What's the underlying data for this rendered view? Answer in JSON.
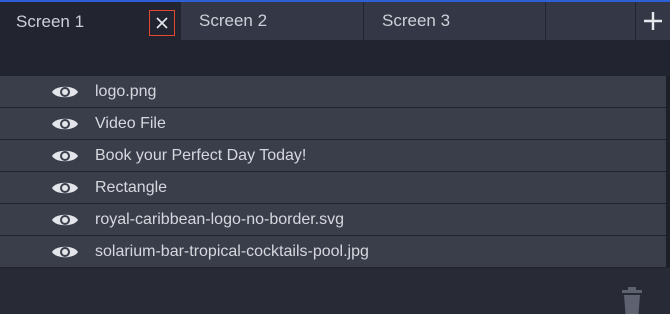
{
  "tabs": [
    {
      "label": "Screen 1",
      "active": true
    },
    {
      "label": "Screen 2",
      "active": false
    },
    {
      "label": "Screen 3",
      "active": false
    }
  ],
  "tab_close_icon": "close-icon",
  "add_tab_icon": "plus-icon",
  "layers": [
    {
      "label": "logo.png",
      "icon": "eye-icon"
    },
    {
      "label": "Video File",
      "icon": "eye-icon"
    },
    {
      "label": "Book your Perfect Day Today!",
      "icon": "eye-icon"
    },
    {
      "label": "Rectangle",
      "icon": "eye-icon"
    },
    {
      "label": "royal-caribbean-logo-no-border.svg",
      "icon": "eye-icon"
    },
    {
      "label": "solarium-bar-tropical-cocktails-pool.jpg",
      "icon": "eye-icon"
    }
  ],
  "footer": {
    "delete_icon": "trash-icon"
  },
  "colors": {
    "accent": "#2d5fd6",
    "close_highlight": "#e0482f",
    "row_bg": "#3a3e4b",
    "panel_bg": "#282b36"
  }
}
